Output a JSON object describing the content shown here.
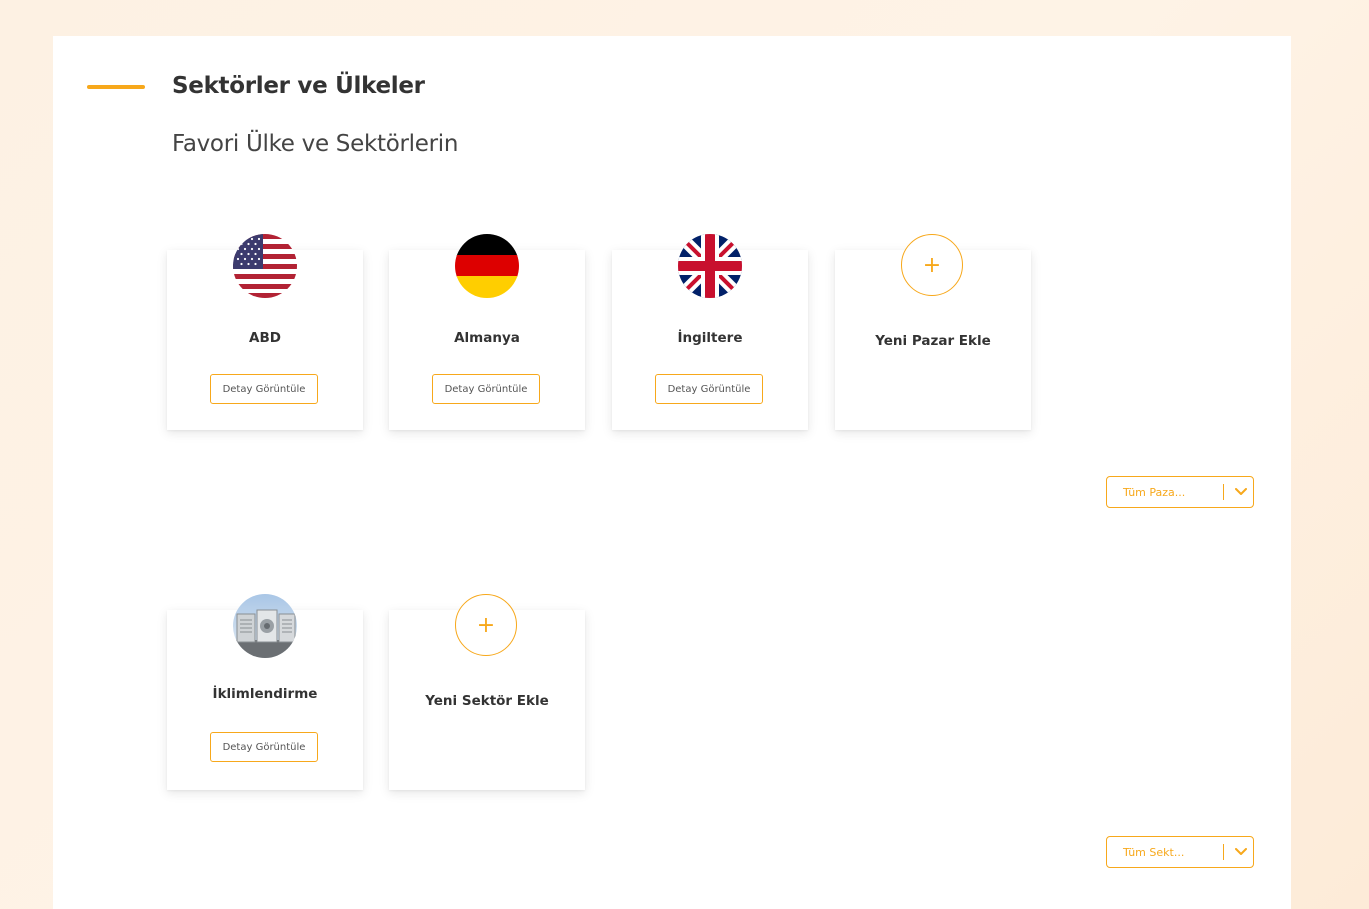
{
  "section": {
    "title": "Sektörler ve Ülkeler",
    "subtitle": "Favori Ülke ve Sektörlerin"
  },
  "markets": [
    {
      "label": "ABD",
      "icon": "usa-flag-icon",
      "button": "Detay Görüntüle"
    },
    {
      "label": "Almanya",
      "icon": "germany-flag-icon",
      "button": "Detay Görüntüle"
    },
    {
      "label": "İngiltere",
      "icon": "uk-flag-icon",
      "button": "Detay Görüntüle"
    }
  ],
  "add_market": {
    "label": "Yeni Pazar Ekle",
    "icon": "plus-icon",
    "symbol": "+"
  },
  "markets_dropdown": {
    "label": "Tüm Paza...",
    "icon": "chevron-down-icon"
  },
  "sectors": [
    {
      "label": "İklimlendirme",
      "icon": "air-conditioning-icon",
      "button": "Detay Görüntüle"
    }
  ],
  "add_sector": {
    "label": "Yeni Sektör Ekle",
    "icon": "plus-icon",
    "symbol": "+"
  },
  "sectors_dropdown": {
    "label": "Tüm Sekt...",
    "icon": "chevron-down-icon"
  },
  "colors": {
    "accent": "#f7a81b",
    "background": "#fdf1e3",
    "panel": "#ffffff",
    "text": "#333333"
  }
}
